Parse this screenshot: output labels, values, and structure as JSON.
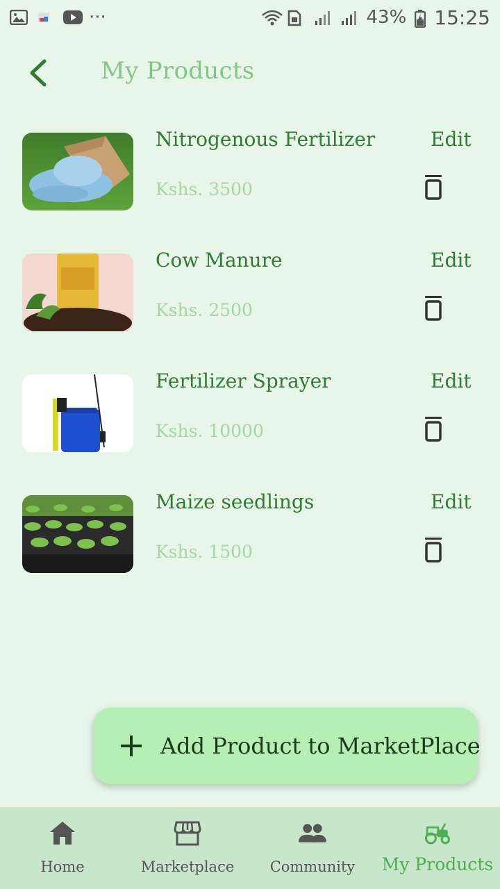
{
  "status_bar": {
    "battery_pct": "43%",
    "time": "15:25",
    "more_glyph": "···"
  },
  "header": {
    "title": "My Products",
    "back_icon": "chevron-left-icon"
  },
  "products": [
    {
      "name": "Nitrogenous Fertilizer",
      "price": "Kshs. 3500",
      "edit_label": "Edit",
      "image": "fertilizer-bag-image"
    },
    {
      "name": "Cow Manure",
      "price": "Kshs. 2500",
      "edit_label": "Edit",
      "image": "cow-manure-bag-image"
    },
    {
      "name": "Fertilizer Sprayer",
      "price": "Kshs. 10000",
      "edit_label": "Edit",
      "image": "sprayer-image"
    },
    {
      "name": "Maize seedlings",
      "price": "Kshs. 1500",
      "edit_label": "Edit",
      "image": "seedlings-image"
    }
  ],
  "fab": {
    "label": "Add Product to MarketPlace",
    "icon": "plus-icon"
  },
  "bottom_nav": {
    "items": [
      {
        "label": "Home",
        "icon": "home-icon",
        "active": false
      },
      {
        "label": "Marketplace",
        "icon": "storefront-icon",
        "active": false
      },
      {
        "label": "Community",
        "icon": "people-icon",
        "active": false
      },
      {
        "label": "My Products",
        "icon": "tractor-icon",
        "active": true
      }
    ]
  },
  "colors": {
    "background": "#e8f5e9",
    "title": "#81c784",
    "text_primary": "#2e7d32",
    "price": "#a5d6a7",
    "fab": "#b5efb3",
    "nav_bg": "#c8e6c9",
    "nav_active": "#4caf50"
  }
}
